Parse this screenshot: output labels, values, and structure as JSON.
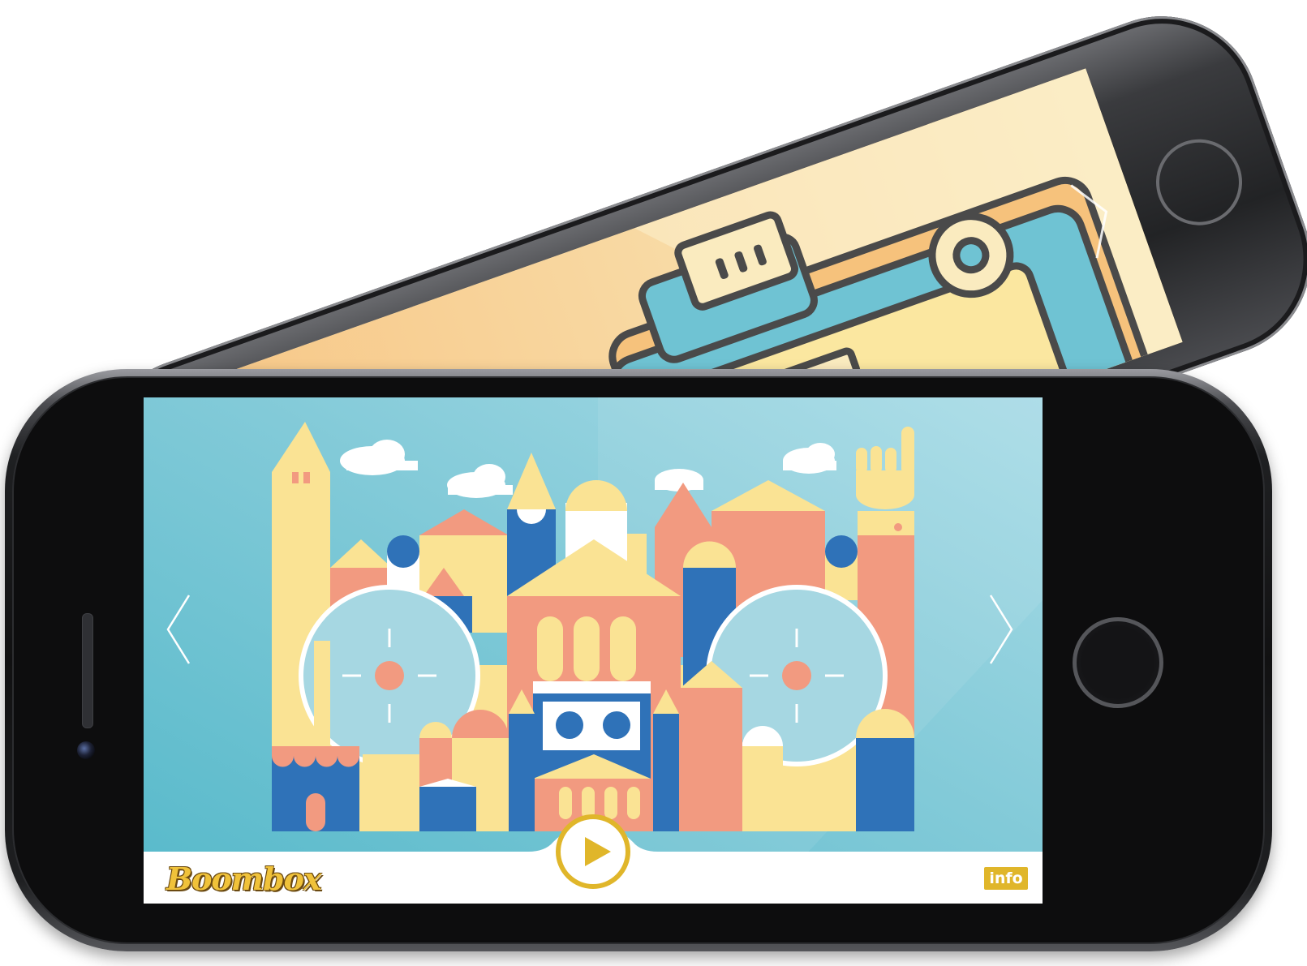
{
  "app": {
    "logo_text": "Boombox",
    "info_label": "info"
  },
  "icons": {
    "play": "play-icon",
    "previous": "chevron-left-icon",
    "next": "chevron-right-icon"
  },
  "colors": {
    "accent": "#e0b62a",
    "sky": "#6fc3d3",
    "blue": "#2f72b8",
    "salmon": "#f29a80",
    "cream": "#fae394",
    "light_blue": "#a6d7e2"
  }
}
